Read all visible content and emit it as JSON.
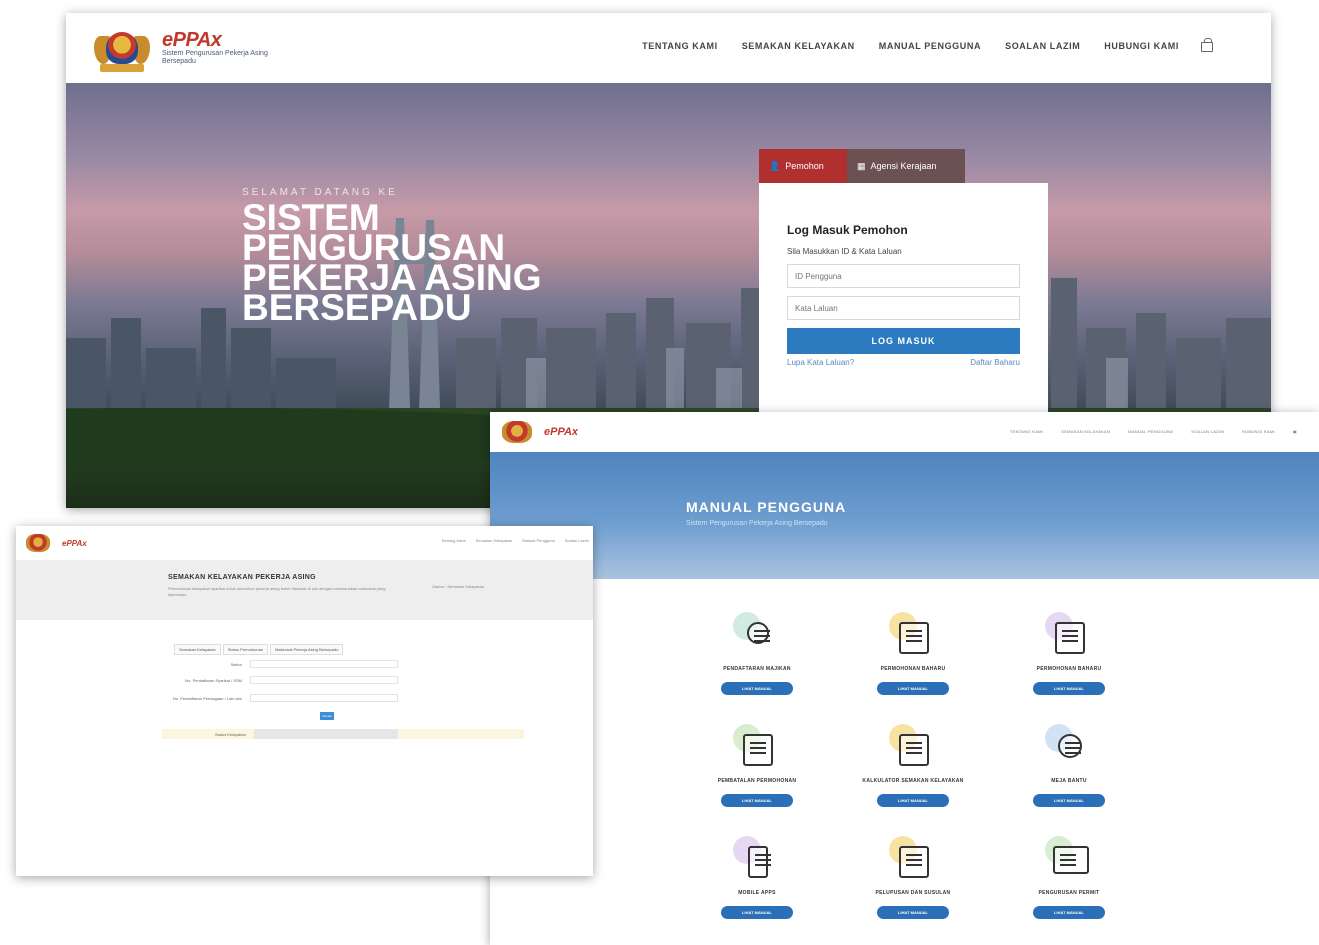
{
  "main": {
    "brand_logo": "ePPAx",
    "brand_sub": "Sistem Pengurusan Pekerja Asing Bersepadu",
    "nav": [
      "TENTANG KAMI",
      "SEMAKAN KELAYAKAN",
      "MANUAL PENGGUNA",
      "SOALAN LAZIM",
      "HUBUNGI KAMI"
    ],
    "hero_welcome": "SELAMAT DATANG KE",
    "hero_title": "SISTEM PENGURUSAN PEKERJA ASING BERSEPADU",
    "tab_applicant": "Pemohon",
    "tab_agency": "Agensi Kerajaan",
    "login_title": "Log Masuk Pemohon",
    "login_sub": "Sila Masukkan ID & Kata Laluan",
    "user_placeholder": "ID Pengguna",
    "password_placeholder": "Kata Laluan",
    "login_button": "LOG MASUK",
    "forgot_link": "Lupa Kata Laluan?",
    "register_link": "Daftar Baharu"
  },
  "left": {
    "brand": "ePPAx",
    "nav": [
      "Tentang Kami",
      "Semakan Kelayakan",
      "Manual Pengguna",
      "Soalan Lazim"
    ],
    "title": "SEMAKAN KELAYAKAN PEKERJA ASING",
    "desc": "Permohonan kelayakan syarikat untuk memohon pekerja asing boleh disemak di sini dengan memasukkan maklumat yang diperlukan.",
    "breadcrumb": "Utama › Semakan Kelayakan",
    "tabs": [
      "Semakan Kelayakan",
      "Status Permohonan",
      "Maklumat Pekerja Asing Bersepadu"
    ],
    "fields": [
      "Sektor",
      "No. Pendaftaran Syarikat / SSM",
      "No. Pendaftaran Perniagaan / Lain-lain"
    ],
    "button": "Semak",
    "result_label": "Status Kelayakan"
  },
  "right": {
    "brand": "ePPAx",
    "nav": [
      "TENTANG KAMI",
      "SEMAKAN KELAYAKAN",
      "MANUAL PENGGUNA",
      "SOALAN LAZIM",
      "HUBUNGI KAMI"
    ],
    "title": "MANUAL PENGGUNA",
    "subtitle": "Sistem Pengurusan Pekerja Asing Bersepadu",
    "button_label": "LIHAT MANUAL",
    "items": [
      {
        "label": "PENDAFTARAN MAJIKAN",
        "color": "#bfe3d6"
      },
      {
        "label": "PERMOHONAN BAHARU",
        "color": "#f3d67a"
      },
      {
        "label": "PERMOHONAN BAHARU",
        "color": "#d9c8ec"
      },
      {
        "label": "PEMBATALAN PERMOHONAN",
        "color": "#c8e6b8"
      },
      {
        "label": "KALKULATOR SEMAKAN KELAYAKAN",
        "color": "#f3d67a"
      },
      {
        "label": "MEJA BANTU",
        "color": "#bcd6ee"
      },
      {
        "label": "MOBILE APPS",
        "color": "#dcc6ee"
      },
      {
        "label": "PELUPUSAN DAN SUSULAN",
        "color": "#f3d67a"
      },
      {
        "label": "PENGURUSAN PERMIT",
        "color": "#c8e6c0"
      }
    ]
  }
}
